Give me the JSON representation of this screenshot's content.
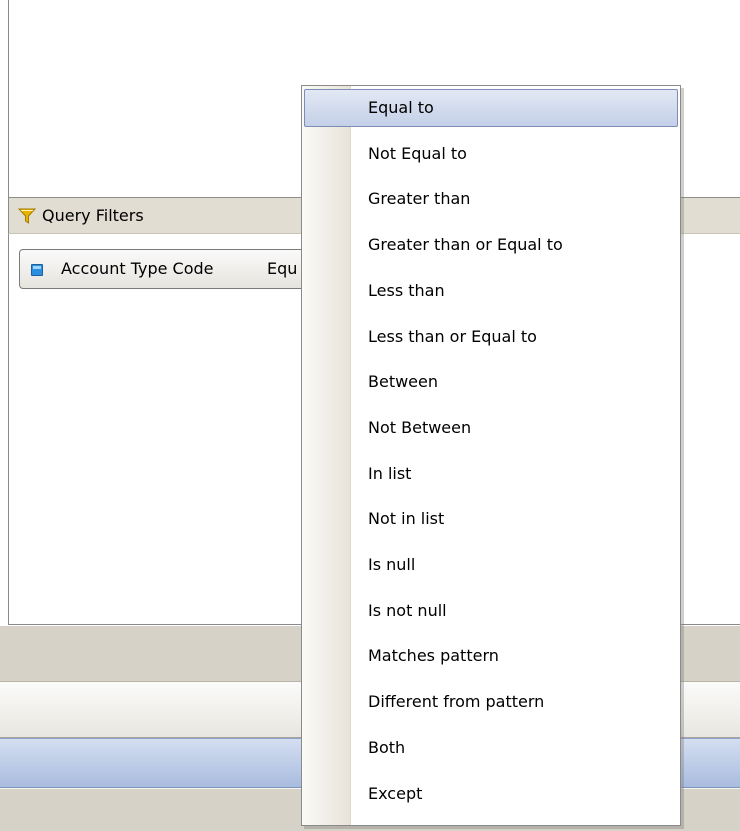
{
  "query_filters": {
    "title": "Query Filters",
    "filter": {
      "object": "Account Type Code",
      "operator": "Equ"
    }
  },
  "context_menu": {
    "highlighted_index": 0,
    "items": [
      {
        "label": "Equal to"
      },
      {
        "label": "Not Equal to"
      },
      {
        "label": "Greater than"
      },
      {
        "label": "Greater than or Equal to"
      },
      {
        "label": "Less than"
      },
      {
        "label": "Less than or Equal to"
      },
      {
        "label": "Between"
      },
      {
        "label": "Not Between"
      },
      {
        "label": "In list"
      },
      {
        "label": "Not in list"
      },
      {
        "label": "Is null"
      },
      {
        "label": "Is not null"
      },
      {
        "label": "Matches pattern"
      },
      {
        "label": "Different from pattern"
      },
      {
        "label": "Both"
      },
      {
        "label": "Except"
      }
    ]
  },
  "colors": {
    "highlight": "#c4d0e8",
    "panel_header": "#e2ddd2",
    "funnel": "#e8b400"
  },
  "icons": {
    "panel": "funnel-icon",
    "filter_object": "dimension-object-icon"
  }
}
